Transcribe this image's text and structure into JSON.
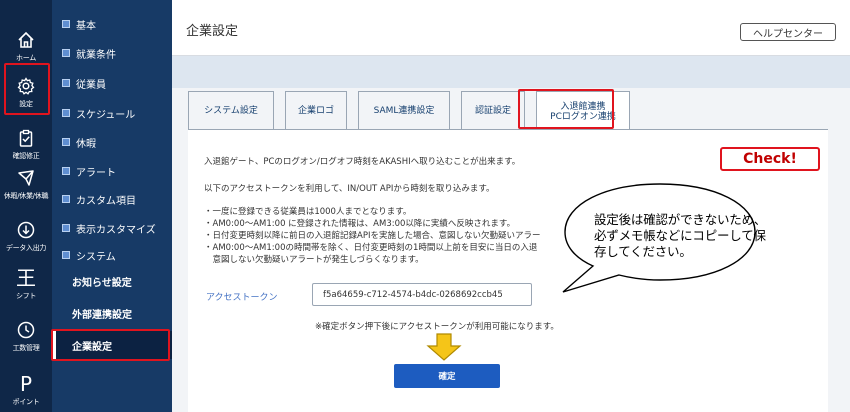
{
  "rail": {
    "items": [
      {
        "label": "ホーム",
        "icon": "home-icon"
      },
      {
        "label": "設定",
        "icon": "gear-icon"
      },
      {
        "label": "確認修正",
        "icon": "clipboard-icon"
      },
      {
        "label": "休暇/休業/休職",
        "icon": "plane-icon"
      },
      {
        "label": "データ入出力",
        "icon": "download-icon"
      },
      {
        "label": "シフト",
        "glyph": "王"
      },
      {
        "label": "工数管理",
        "icon": "clock-icon"
      },
      {
        "label": "ポイント",
        "glyph": "P"
      }
    ]
  },
  "menu": {
    "items": [
      {
        "label": "基本"
      },
      {
        "label": "就業条件"
      },
      {
        "label": "従業員"
      },
      {
        "label": "スケジュール"
      },
      {
        "label": "休暇"
      },
      {
        "label": "アラート"
      },
      {
        "label": "カスタム項目"
      },
      {
        "label": "表示カスタマイズ"
      },
      {
        "label": "システム"
      }
    ],
    "sub_items": [
      {
        "label": "お知らせ設定"
      },
      {
        "label": "外部連携設定"
      },
      {
        "label": "企業設定"
      }
    ]
  },
  "header": {
    "title": "企業設定",
    "help_label": "ヘルプセンター"
  },
  "tabs": [
    {
      "label": "システム設定"
    },
    {
      "label": "企業ロゴ"
    },
    {
      "label": "SAML連携設定"
    },
    {
      "label": "認証設定"
    },
    {
      "line1": "入退館連携",
      "line2": "PCログオン連携"
    }
  ],
  "panel": {
    "intro": "入退館ゲート、PCのログオン/ログオフ時刻をAKASHIへ取り込むことが出来ます。",
    "intro2": "以下のアクセストークンを利用して、IN/OUT APIから時刻を取り込みます。",
    "notes": [
      "・一度に登録できる従業員は1000人までとなります。",
      "・AM0:00～AM1:00 に登録された情報は、AM3:00以降に実績へ反映されます。",
      "・日付変更時刻以降に前日の入退館記録APIを実施した場合、意図しない欠勤疑いアラー",
      "・AM0:00～AM1:00の時間帯を除く、日付変更時刻の1時間以上前を目安に当日の入退",
      "　意図しない欠勤疑いアラートが発生しづらくなります。"
    ],
    "token_label": "アクセストークン",
    "token_value": "f5a64659-c712-4574-b4dc-0268692ccb45",
    "hint": "※確定ボタン押下後にアクセストークンが利用可能になります。",
    "confirm_label": "確定"
  },
  "annotation": {
    "check_label": "Check!",
    "callout": "設定後は確認ができないため、必ずメモ帳などにコピーして保存してください。"
  },
  "colors": {
    "rail_bg": "#0f2748",
    "menu_bg": "#173a66",
    "highlight": "#e0141e",
    "primary_button": "#1d5cc0",
    "arrow_fill": "#f5c518"
  }
}
